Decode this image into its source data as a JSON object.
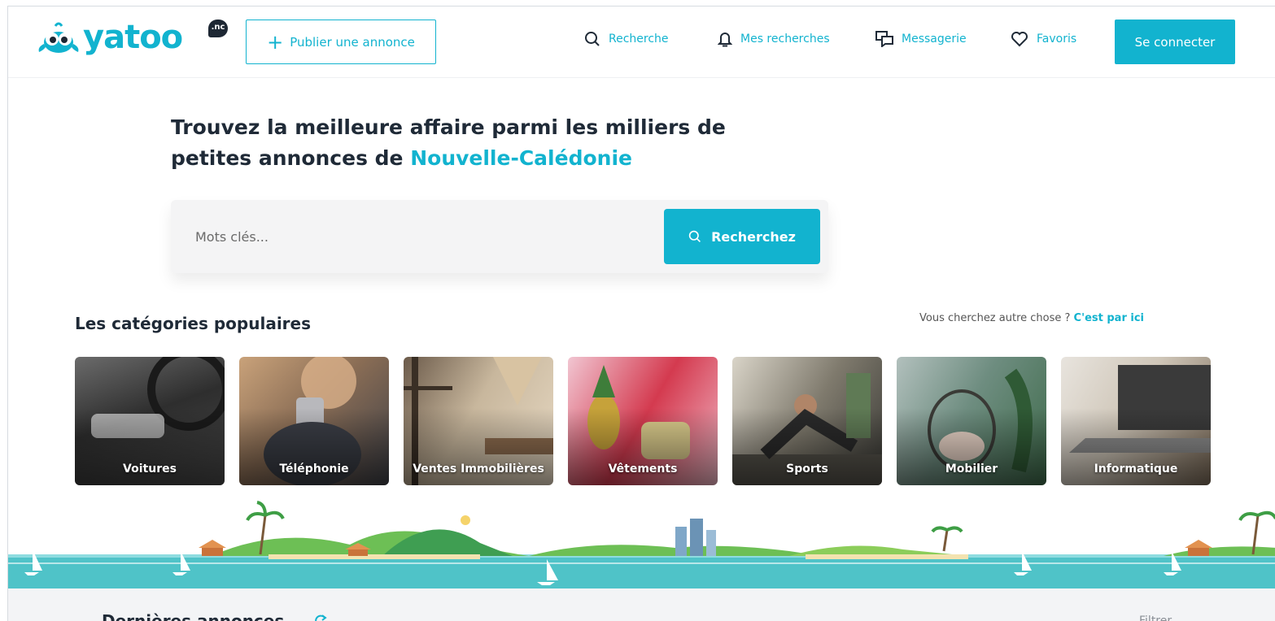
{
  "header": {
    "logo_text": "yatoo",
    "logo_badge": ".nc",
    "publish_label": "Publier une annonce",
    "nav": [
      {
        "label": "Recherche",
        "icon": "search-icon"
      },
      {
        "label": "Mes recherches",
        "icon": "bell-icon"
      },
      {
        "label": "Messagerie",
        "icon": "chat-icon"
      },
      {
        "label": "Favoris",
        "icon": "heart-icon"
      }
    ],
    "login_label": "Se connecter"
  },
  "hero": {
    "title_line1": "Trouvez la meilleure affaire parmi les milliers de",
    "title_line2_prefix": "petites annonces de ",
    "title_line2_accent": "Nouvelle-Calédonie"
  },
  "search": {
    "placeholder": "Mots clés...",
    "button_label": "Recherchez"
  },
  "categories": {
    "title": "Les catégories populaires",
    "other_prefix": "Vous cherchez autre chose ? ",
    "other_link": "C'est par ici",
    "items": [
      {
        "label": "Voitures"
      },
      {
        "label": "Téléphonie"
      },
      {
        "label": "Ventes Immobilières"
      },
      {
        "label": "Vêtements"
      },
      {
        "label": "Sports"
      },
      {
        "label": "Mobilier"
      },
      {
        "label": "Informatique"
      }
    ]
  },
  "latest": {
    "title": "Dernières annonces",
    "filter_label": "Filtrer"
  },
  "colors": {
    "accent": "#12b3cf",
    "text_dark": "#1f2a37",
    "sea": "#4fc3c8"
  }
}
